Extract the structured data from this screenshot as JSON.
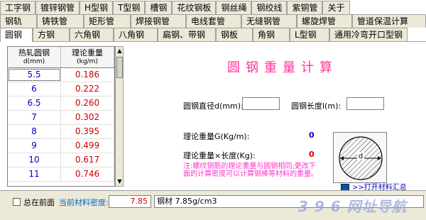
{
  "tabs_row1": [
    "工字钢",
    "镀锌钢管",
    "H型钢",
    "T型钢",
    "槽钢",
    "花纹钢板",
    "钢丝绳",
    "钢绞线",
    "紫铜管",
    "关于"
  ],
  "tabs_row2": [
    "钢轨",
    "铸铁管",
    "矩形管",
    "焊接钢管",
    "电线套管",
    "无缝钢管",
    "螺旋焊管",
    "管道保温计算"
  ],
  "tabs_row3": [
    "圆钢",
    "方钢",
    "六角钢",
    "八角钢",
    "扁钢、带钢",
    "钢板",
    "角钢",
    "L型钢",
    "通用冷弯开口型钢"
  ],
  "table": {
    "col1_header": "热轧圆钢",
    "col1_unit": "d(mm)",
    "col2_header": "理论重量",
    "col2_unit": "(kg/m)",
    "rows": [
      {
        "d": "5.5",
        "w": "0.186"
      },
      {
        "d": "6",
        "w": "0.222"
      },
      {
        "d": "6.5",
        "w": "0.260"
      },
      {
        "d": "7",
        "w": "0.302"
      },
      {
        "d": "8",
        "w": "0.395"
      },
      {
        "d": "9",
        "w": "0.499"
      },
      {
        "d": "10",
        "w": "0.617"
      },
      {
        "d": "11",
        "w": "0.746"
      }
    ]
  },
  "calc": {
    "title": "圆钢重量计算",
    "diameter_label": "圆钢直径d(mm):",
    "length_label": "圆钢长度l(m):",
    "weight_per_m_label": "理论重量G(Kg/m):",
    "weight_per_m_value": "0",
    "total_weight_label": "理论重量×长度(Kg):",
    "total_weight_value": "0",
    "note": "注:螺纹钢筋的理论重量与圆钢相同;更改下面的计算密度可以计算钢棒等材料的重量。",
    "circle_label": "d",
    "open_link": ">>打开材料汇总"
  },
  "status": {
    "always_on_top": "总在前面",
    "density_label": "当前材料密度:",
    "density_value": "7.85",
    "material_value": "钢材 7.85g/cm3",
    "watermark": "3 9 6 网址导航"
  }
}
